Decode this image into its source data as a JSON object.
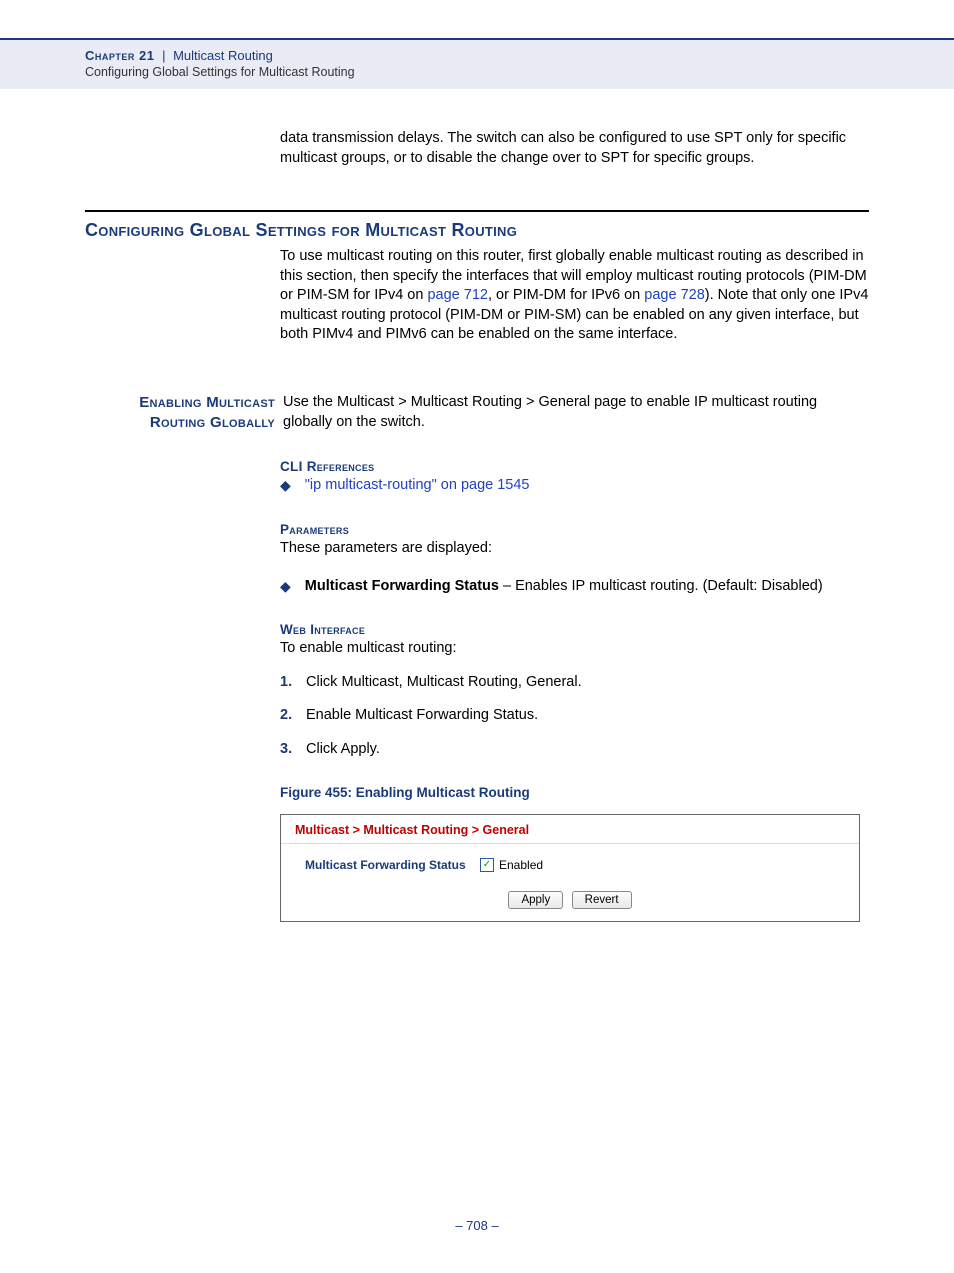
{
  "header": {
    "chapter_label": "Chapter 21",
    "chapter_title": "Multicast Routing",
    "subtitle": "Configuring Global Settings for Multicast Routing"
  },
  "intro_carryover": "data transmission delays. The switch can also be configured to use SPT only for specific multicast groups, or to disable the change over to SPT for specific groups.",
  "section_heading": "Configuring Global Settings for Multicast Routing",
  "section_para": {
    "p1": "To use multicast routing on this router, first globally enable multicast routing as described in this section, then specify the interfaces that will employ multicast routing protocols (PIM-DM or PIM-SM for IPv4 on ",
    "link1": "page 712",
    "p2": ", or PIM-DM for IPv6 on ",
    "link2": "page 728",
    "p3": "). Note that only one IPv4 multicast routing protocol (PIM-DM or PIM-SM) can be enabled on any given interface, but both PIMv4 and PIMv6 can be enabled on the same interface."
  },
  "side": {
    "heading_l1": "Enabling Multicast",
    "heading_l2": "Routing Globally",
    "body": "Use the Multicast > Multicast Routing > General page to enable IP multicast routing globally on the switch."
  },
  "cli": {
    "heading": "CLI References",
    "link": "\"ip multicast-routing\" on page 1545"
  },
  "params": {
    "heading": "Parameters",
    "intro": "These parameters are displayed:",
    "item_bold": "Multicast Forwarding Status",
    "item_rest": " – Enables IP multicast routing. (Default: Disabled)"
  },
  "web": {
    "heading": "Web Interface",
    "intro": "To enable multicast routing:",
    "steps": [
      "Click Multicast, Multicast Routing, General.",
      "Enable Multicast Forwarding Status.",
      "Click Apply."
    ]
  },
  "figure": {
    "caption": "Figure 455:  Enabling Multicast Routing",
    "breadcrumb": "Multicast > Multicast Routing > General",
    "field_label": "Multicast Forwarding Status",
    "checkbox_label": "Enabled",
    "btn_apply": "Apply",
    "btn_revert": "Revert"
  },
  "footer": {
    "page": "–  708  –"
  }
}
